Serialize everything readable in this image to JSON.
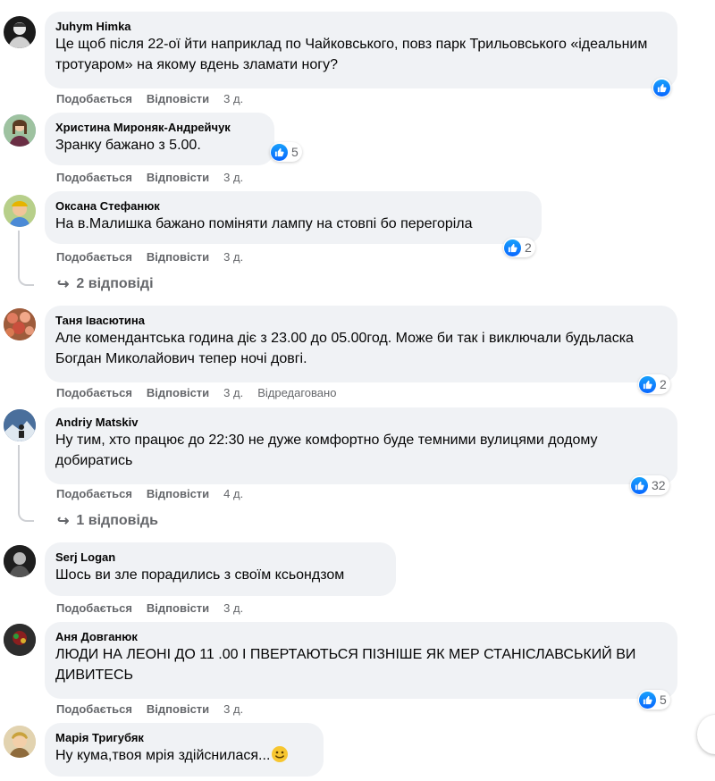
{
  "labels": {
    "like": "Подобається",
    "reply": "Відповісти"
  },
  "comments": [
    {
      "author": "Juhym Himka",
      "text": "Це щоб після 22-ої йти наприклад по Чайковського, повз парк Трильовського «ідеальним тротуаром» на якому вдень зламати ногу?",
      "time": "3 д.",
      "reactions": ""
    },
    {
      "author": "Христина Мироняк-Андрейчук",
      "text": "Зранку бажано з 5.00.",
      "time": "3 д.",
      "reactions": "5"
    },
    {
      "author": "Оксана Стефанюк",
      "text": "На в.Малишка бажано поміняти лампу на стовпі бо перегоріла",
      "time": "3 д.",
      "reactions": "2",
      "replies": "2 відповіді"
    },
    {
      "author": "Таня Івасютина",
      "text": "Але комендантська година діє з 23.00 до 05.00год. Може би так і виключали будьласка Богдан Миколайович тепер ночі довгі.",
      "time": "3 д.",
      "edited": "Відредаговано",
      "reactions": "2"
    },
    {
      "author": "Andriy Matskiv",
      "text": "Ну тим, хто працює до 22:30 не дуже комфортно буде темними вулицями додому добиратись",
      "time": "4 д.",
      "reactions": "32",
      "replies": "1 відповідь"
    },
    {
      "author": "Serj Logan",
      "text": "Шось ви зле порадились з своїм ксьондзом",
      "time": "3 д.",
      "reactions": ""
    },
    {
      "author": "Аня Довганюк",
      "text": "ЛЮДИ НА ЛЕОНІ ДО 11 .00 І ПВЕРТАЮТЬСЯ ПІЗНІШЕ ЯК МЕР СТАНІСЛАВСЬКИЙ ВИ ДИВИТЕСЬ",
      "time": "3 д.",
      "reactions": "5"
    },
    {
      "author": "Марія Тригубяк",
      "text": "Ну кума,твоя мрія здійснилася...",
      "time": "",
      "reactions": ""
    }
  ],
  "colors": {
    "bubble": "#f0f2f5",
    "like_blue": "#0866ff",
    "meta_gray": "#65676b"
  },
  "icons": [
    "like-icon",
    "reply-arrow-icon",
    "smile-emoji-icon",
    "avatar"
  ]
}
